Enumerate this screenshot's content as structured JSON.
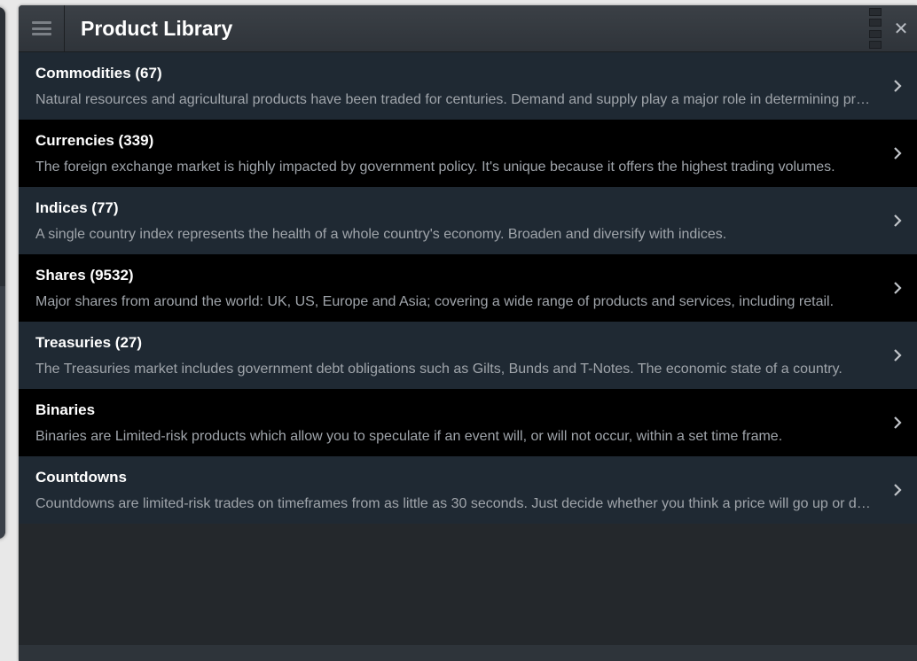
{
  "window": {
    "title": "Product Library",
    "menu_icon": "hamburger-icon",
    "close_icon": "close-icon",
    "close_label": "✕"
  },
  "colors": {
    "row_light": "#1f2933",
    "row_dark": "#000000",
    "title_text": "#ffffff",
    "desc_text": "#a0a5ab"
  },
  "products": [
    {
      "title": "Commodities (67)",
      "description": "Natural resources and agricultural products have been traded for centuries. Demand and supply play a major role in determining prices."
    },
    {
      "title": "Currencies (339)",
      "description": "The foreign exchange market is highly impacted by government policy. It's unique because it offers the highest trading volumes."
    },
    {
      "title": "Indices (77)",
      "description": "A single country index represents the health of a whole country's economy. Broaden and diversify with indices."
    },
    {
      "title": "Shares (9532)",
      "description": "Major shares from around the world: UK, US, Europe and Asia; covering a wide range of products and services, including retail."
    },
    {
      "title": "Treasuries (27)",
      "description": "The Treasuries market includes government debt obligations such as Gilts, Bunds and T-Notes. The economic state of a country."
    },
    {
      "title": "Binaries",
      "description": "Binaries are Limited-risk products which allow you to speculate if an event will, or will not occur, within a set time frame."
    },
    {
      "title": "Countdowns",
      "description": "Countdowns are limited-risk trades on timeframes from as little as 30 seconds.  Just decide whether you think a price will go up or down."
    }
  ]
}
